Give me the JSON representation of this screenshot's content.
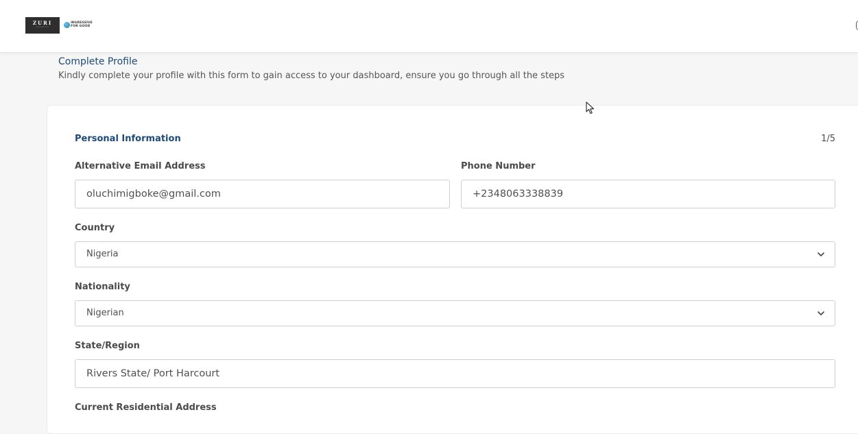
{
  "header": {
    "logo_primary": "ZURI",
    "logo_primary_sub": "TRAINING",
    "logo_secondary_line1": "INGRESSIVE",
    "logo_secondary_line2": "FOR GOOD"
  },
  "page": {
    "title": "Complete Profile",
    "subtitle": "Kindly complete your profile with this form to gain access to your dashboard, ensure you go through all the steps"
  },
  "form": {
    "section_title": "Personal Information",
    "step_indicator": "1/5",
    "alt_email": {
      "label": "Alternative Email Address",
      "value": "oluchimigboke@gmail.com"
    },
    "phone": {
      "label": "Phone Number",
      "value": "+2348063338839"
    },
    "country": {
      "label": "Country",
      "selected": "Nigeria"
    },
    "nationality": {
      "label": "Nationality",
      "selected": "Nigerian"
    },
    "state": {
      "label": "State/Region",
      "value": "Rivers State/ Port Harcourt"
    },
    "address": {
      "label": "Current Residential Address"
    }
  },
  "colors": {
    "accent": "#1e4a7a",
    "background": "#f6f6f6",
    "card": "#ffffff",
    "border": "#cfcfcf"
  },
  "icons": {
    "select_arrow": "chevron-down-icon",
    "pointer": "mouse-cursor-icon"
  }
}
